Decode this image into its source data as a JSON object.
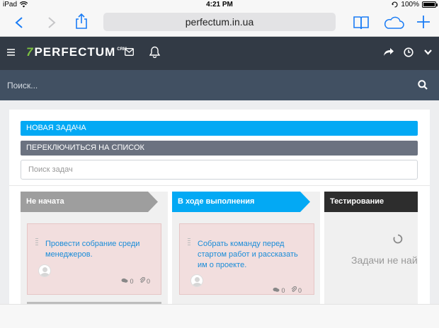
{
  "status_bar": {
    "device": "iPad",
    "time": "4:21 PM",
    "battery": "100%"
  },
  "browser": {
    "url": "perfectum.in.ua",
    "back_icon": "chevron-left-icon",
    "forward_icon": "chevron-right-icon",
    "share_icon": "share-icon",
    "bookmarks_icon": "book-icon",
    "cloud_icon": "cloud-icon",
    "new_tab_icon": "plus-icon"
  },
  "header": {
    "logo_mark": "7",
    "logo_text": "PERFECTUM",
    "logo_sup": "CRM"
  },
  "search": {
    "placeholder": "Поиск..."
  },
  "actions": {
    "new_task": "НОВАЯ ЗАДАЧА",
    "switch_list": "ПЕРЕКЛЮЧИТЬСЯ НА СПИСОК",
    "task_search_placeholder": "Поиск задач"
  },
  "columns": [
    {
      "title": "Не начата",
      "color": "#9e9e9e",
      "cards": [
        {
          "title": "Провести собрание среди менеджеров.",
          "comments": "0",
          "attachments": "0"
        }
      ]
    },
    {
      "title": "В ходе выполнения",
      "color": "#03a9f4",
      "cards": [
        {
          "title": "Собрать команду перед стартом работ и рассказать им о проекте.",
          "comments": "0",
          "attachments": "0"
        }
      ]
    },
    {
      "title": "Тестирование",
      "color": "#2d2d2d",
      "empty_text": "Задачи не най"
    }
  ],
  "colors": {
    "header_bg": "#323a45",
    "search_bg": "#415062",
    "accent": "#03a9f4",
    "card_bg": "#f2dede",
    "logo_green": "#7dc242"
  }
}
